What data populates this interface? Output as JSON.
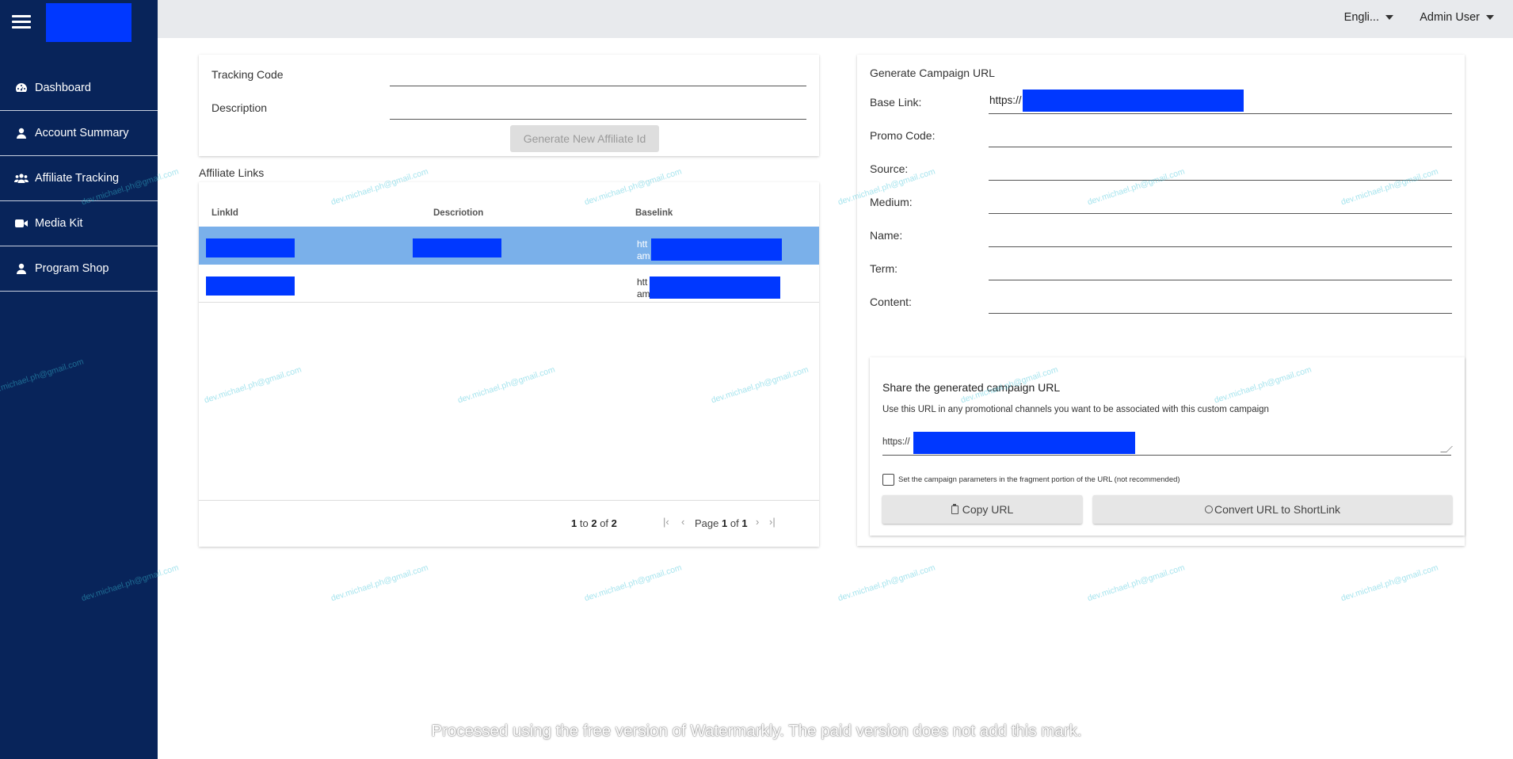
{
  "sidebar": {
    "items": [
      {
        "label": "Dashboard"
      },
      {
        "label": "Account Summary"
      },
      {
        "label": "Affiliate Tracking"
      },
      {
        "label": "Media Kit"
      },
      {
        "label": "Program Shop"
      }
    ]
  },
  "topbar": {
    "language": "Engli...",
    "user": "Admin User"
  },
  "affiliate_form": {
    "tracking_code_label": "Tracking Code",
    "description_label": "Description",
    "generate_button": "Generate New Affiliate Id"
  },
  "links_section": {
    "title": "Affiliate Links",
    "columns": [
      "LinkId",
      "Descriotion",
      "Baselink"
    ],
    "rows": [
      {
        "baselink_line1": "htt",
        "baselink_line2": "am"
      },
      {
        "baselink_line1": "htt",
        "baselink_line2": "am"
      }
    ],
    "pager": {
      "from": "1",
      "to_word": "to",
      "to": "2",
      "of_word": "of",
      "total": "2",
      "page_word": "Page",
      "page": "1",
      "page_of_word": "of",
      "pages": "1"
    }
  },
  "campaign": {
    "title": "Generate Campaign URL",
    "base_link_label": "Base Link:",
    "base_link_prefix": "https://",
    "promo_label": "Promo Code:",
    "source_label": "Source:",
    "medium_label": "Medium:",
    "name_label": "Name:",
    "term_label": "Term:",
    "content_label": "Content:"
  },
  "share": {
    "title": "Share the generated campaign URL",
    "description": "Use this URL in any promotional channels you want to be associated with this custom campaign",
    "url_prefix": "https://",
    "checkbox_label": "Set the campaign parameters in the fragment portion of the URL (not recommended)",
    "copy_button": "Copy URL",
    "convert_button": "Convert URL to ShortLink"
  },
  "watermark": {
    "banner": "Processed using the free version of Watermarkly. The paid version does not add this mark.",
    "email": "dev.michael.ph@gmail.com"
  },
  "colors": {
    "sidebar_bg": "#08245a",
    "selected_row": "#7ab0ea",
    "redaction": "#0038ff"
  }
}
